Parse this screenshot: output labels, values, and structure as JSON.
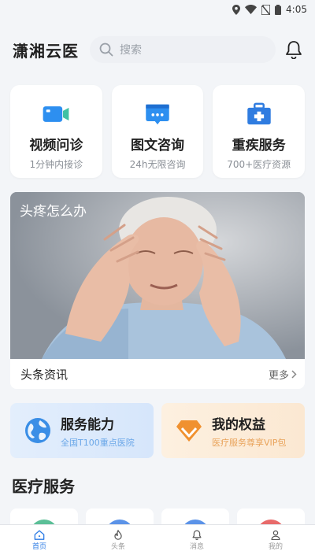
{
  "statusbar": {
    "time": "4:05"
  },
  "header": {
    "title": "潇湘云医",
    "search_placeholder": "搜索"
  },
  "services": [
    {
      "title": "视频问诊",
      "subtitle": "1分钟内接诊",
      "icon": "video-camera-icon"
    },
    {
      "title": "图文咨询",
      "subtitle": "24h无限咨询",
      "icon": "chat-bubble-icon"
    },
    {
      "title": "重疾服务",
      "subtitle": "700+医疗资源",
      "icon": "medical-kit-icon"
    }
  ],
  "news": {
    "image_caption": "头疼怎么办",
    "label": "头条资讯",
    "more": "更多"
  },
  "promos": [
    {
      "title": "服务能力",
      "subtitle": "全国T100重点医院",
      "icon": "globe-icon"
    },
    {
      "title": "我的权益",
      "subtitle": "医疗服务尊享VIP包",
      "icon": "diamond-icon"
    }
  ],
  "section": {
    "title": "医疗服务"
  },
  "colors": {
    "accent_blue": "#2c7be5",
    "service_blue": "#2d8ff0",
    "kit_blue": "#2f7ce0",
    "promo_orange": "#f0912f",
    "teal_circle": "#5bbf97",
    "blue_circle": "#5b93e8",
    "red_circle": "#e86a6a"
  },
  "tabbar": [
    {
      "label": "首页",
      "icon": "home-icon",
      "active": true
    },
    {
      "label": "头条",
      "icon": "flame-icon",
      "active": false
    },
    {
      "label": "消息",
      "icon": "bell-icon",
      "active": false
    },
    {
      "label": "我的",
      "icon": "user-icon",
      "active": false
    }
  ]
}
